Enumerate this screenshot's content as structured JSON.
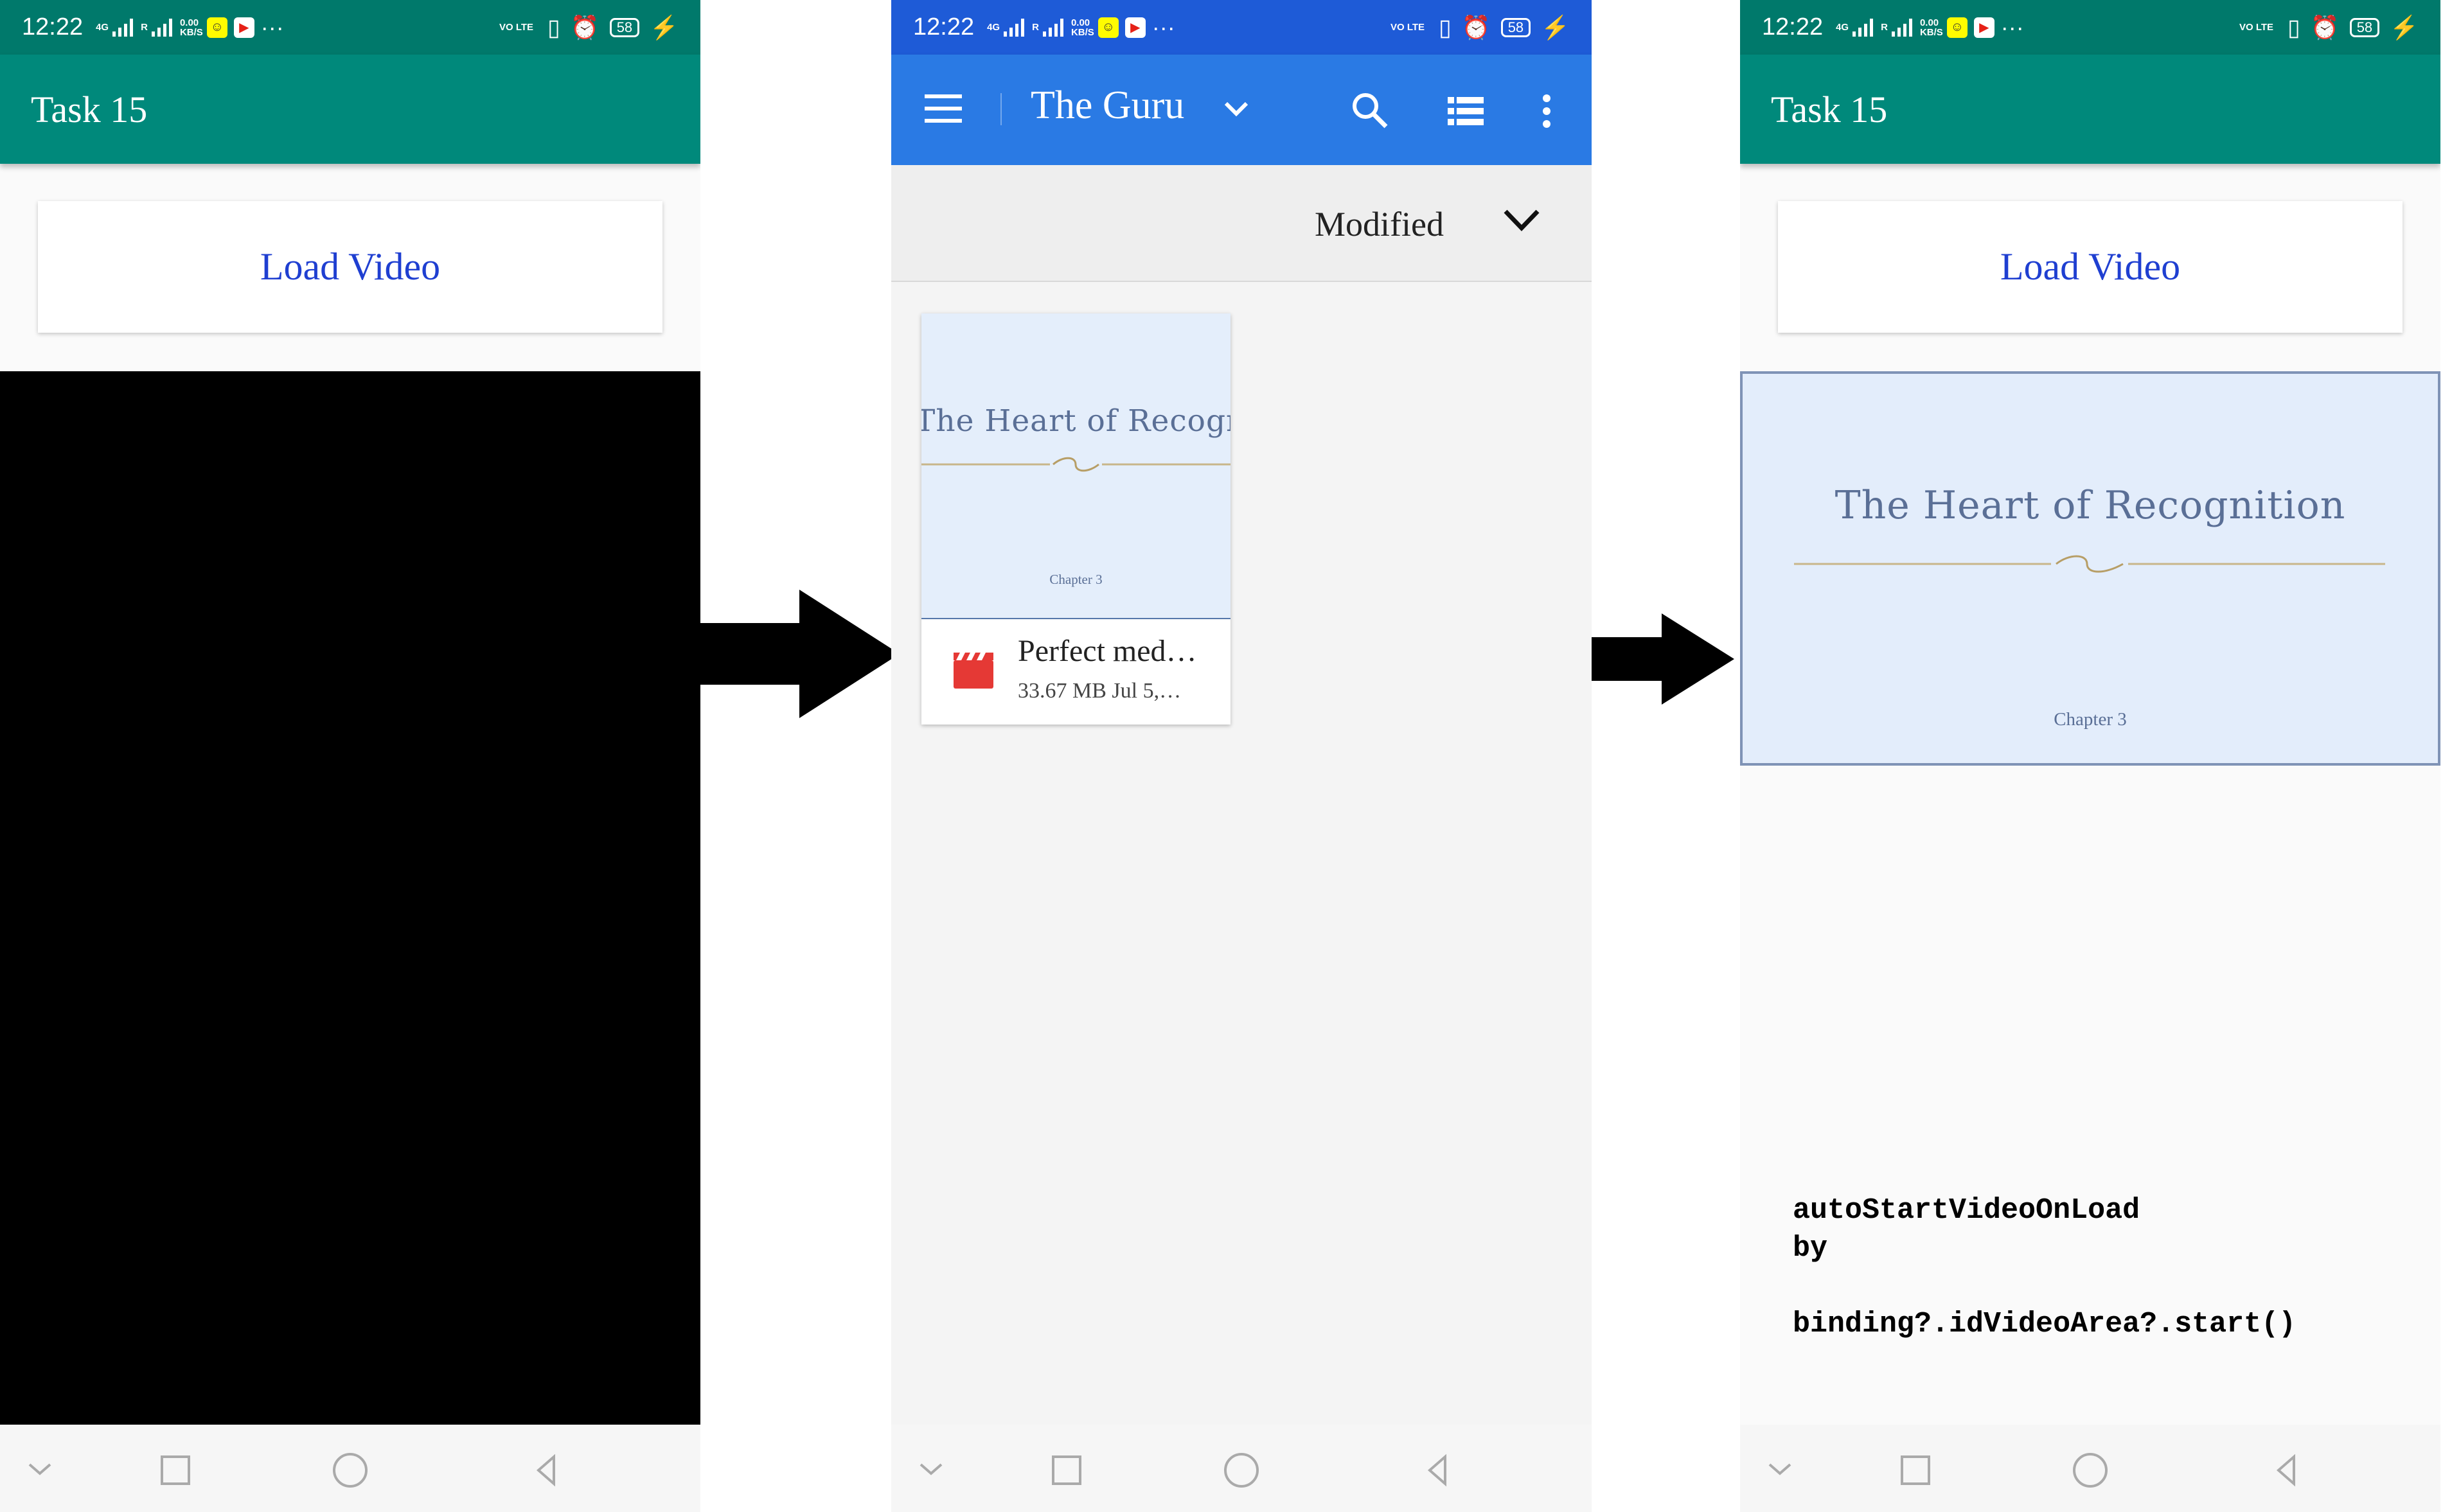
{
  "status_bar": {
    "time": "12:22",
    "network": "4G",
    "roaming": "R",
    "speed_value": "0.00",
    "speed_unit": "KB/S",
    "volte": "VO LTE",
    "battery": "58",
    "more": "···"
  },
  "left_screen": {
    "app_title": "Task 15",
    "load_button": "Load Video"
  },
  "middle_screen": {
    "title": "The Guru",
    "sort_label": "Modified",
    "file": {
      "thumb_title": "The Heart of Recognition",
      "thumb_chapter": "Chapter 3",
      "name": "Perfect med…",
      "meta": "33.67 MB  Jul 5,…"
    }
  },
  "right_screen": {
    "app_title": "Task 15",
    "load_button": "Load Video",
    "video_title": "The Heart of Recognition",
    "video_chapter": "Chapter 3"
  },
  "annotation": {
    "line1": "autoStartVideoOnLoad",
    "line2": "by",
    "line3": "binding?.idVideoArea?.start()"
  },
  "colors": {
    "teal_statusbar": "#00796b",
    "teal_appbar": "#00897b",
    "blue_appbar": "#2a7ae4",
    "link_blue": "#1f3fd1",
    "video_red": "#e53935"
  }
}
